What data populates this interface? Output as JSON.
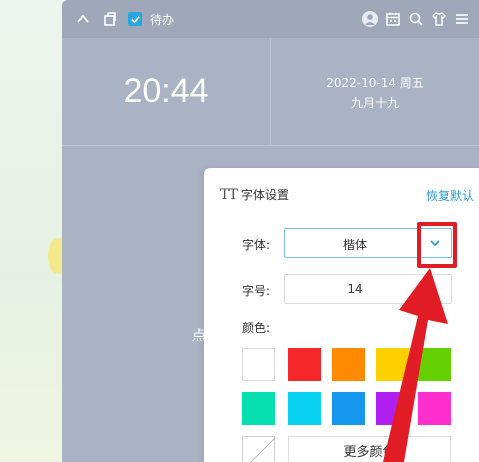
{
  "topbar": {
    "title": "待办",
    "icons": [
      "chevron-up-icon",
      "pin-icon",
      "checkbox-icon",
      "avatar-icon",
      "calendar-icon",
      "search-icon",
      "skin-icon",
      "menu-icon"
    ]
  },
  "clock": {
    "time": "20:44",
    "date": "2022-10-14  周五",
    "lunar": "九月十九"
  },
  "behind": {
    "partial_text": "点"
  },
  "font_settings": {
    "title": "字体设置",
    "restore_label": "恢复默认",
    "font_label": "字体:",
    "font_value": "楷体",
    "size_label": "字号:",
    "size_value": "14",
    "color_label": "颜色:",
    "more_colors_label": "更多颜色",
    "swatches": [
      "#ffffff",
      "#f5272b",
      "#ff8a00",
      "#ffd000",
      "#66d100",
      "#06e0b0",
      "#08d2f0",
      "#1697ef",
      "#b01ff0",
      "#ff2fcf"
    ]
  },
  "colors": {
    "accent": "#2a9fd6",
    "highlight": "#e21c24"
  }
}
